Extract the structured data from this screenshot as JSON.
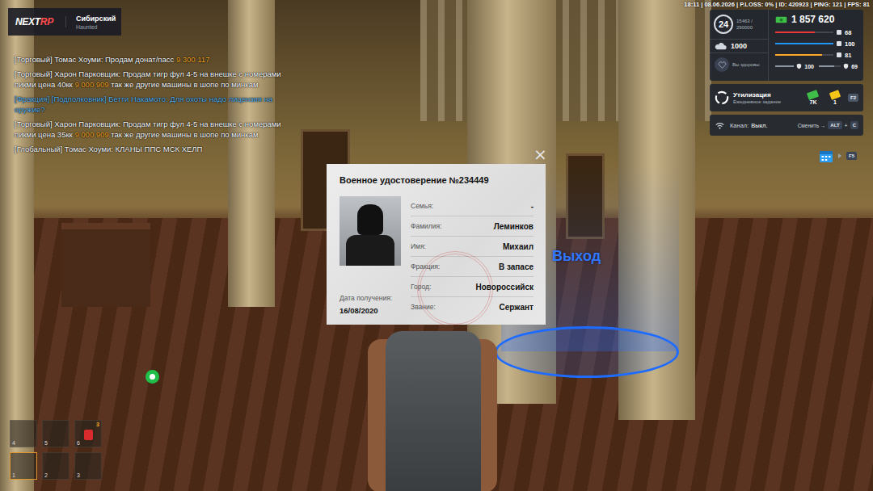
{
  "server": {
    "logo_main": "NEXT",
    "logo_accent": "RP",
    "name": "Сибирский",
    "subtitle": "Haunted"
  },
  "status_line": "18:11 | 08.06.2026 | P.LOSS: 0% | ID: 420923 | PING: 121 | FPS: 81",
  "chat": [
    {
      "segments": [
        {
          "text": "[Торговый] Томас Хоуми: Продам донат/пасс ",
          "color": "#ffffff"
        },
        {
          "text": "9 300 117",
          "color": "#f5a623"
        }
      ]
    },
    {
      "segments": [
        {
          "text": "[Торговый] Харон Парковщик: Продам тигр фул 4-5 на внешке с номерами пикми цена 40кк ",
          "color": "#ffffff"
        },
        {
          "text": "9 000 909",
          "color": "#f5a623"
        },
        {
          "text": " так же другие машины в шопе по минкам",
          "color": "#ffffff"
        }
      ]
    },
    {
      "segments": [
        {
          "text": "[Фракция] [Подполковник] Бетти Накамото: Для охоты надо лицензия на оружие?",
          "color": "#5ab4f0"
        }
      ]
    },
    {
      "segments": [
        {
          "text": "[Торговый] Харон Парковщик: Продам тигр фул 4-5 на внешке с номерами пикми цена 35кк ",
          "color": "#ffffff"
        },
        {
          "text": "9 000 909",
          "color": "#f5a623"
        },
        {
          "text": " так же другие машины в шопе по минкам",
          "color": "#ffffff"
        }
      ]
    },
    {
      "segments": [
        {
          "text": "[Глобальный] Томас Хоуми: КЛАНЫ ППС МСК ХЕЛП",
          "color": "#ffffff"
        }
      ]
    }
  ],
  "hud": {
    "level": "24",
    "exp": "15463 / 290000",
    "donate": "1000",
    "health": "Вы здоровы",
    "money": "1 857 620",
    "bars": [
      {
        "value": "68",
        "level": 0.68,
        "color": "#e53935"
      },
      {
        "value": "100",
        "level": 1,
        "color": "#2196f3"
      },
      {
        "value": "81",
        "level": 0.81,
        "color": "#ffa726"
      }
    ],
    "extras": [
      {
        "value": "100",
        "level": 1
      },
      {
        "value": "69",
        "level": 0.69
      }
    ]
  },
  "daily_task": {
    "title": "Утилизация",
    "subtitle": "Ежедневное задание",
    "rewards": [
      {
        "value": "7K"
      },
      {
        "value": "1"
      }
    ],
    "key": "F2"
  },
  "channel": {
    "label": "Канал:",
    "value": "Выкл.",
    "hint": "Сменить →",
    "keys": [
      "ALT",
      "C"
    ],
    "joiner": "+"
  },
  "calendar": {
    "key": "F5"
  },
  "document": {
    "title": "Военное удостоверение №234449",
    "close": "×",
    "fields": [
      {
        "label": "Семья:",
        "value": "-"
      },
      {
        "label": "Фамилия:",
        "value": "Леминков"
      },
      {
        "label": "Имя:",
        "value": "Михаил"
      },
      {
        "label": "Фракция:",
        "value": "В запасе"
      },
      {
        "label": "Город:",
        "value": "Новороссийск"
      },
      {
        "label": "Звание:",
        "value": "Сержант"
      }
    ],
    "date_label": "Дата получения:",
    "date": "16/08/2020"
  },
  "marker": {
    "label": "Выход"
  },
  "hotbar": [
    {
      "key": "4",
      "selected": false
    },
    {
      "key": "5",
      "selected": false
    },
    {
      "key": "6",
      "count": "3",
      "selected": false
    },
    {
      "key": "1",
      "selected": true
    },
    {
      "key": "2",
      "selected": false
    },
    {
      "key": "3",
      "selected": false
    }
  ]
}
